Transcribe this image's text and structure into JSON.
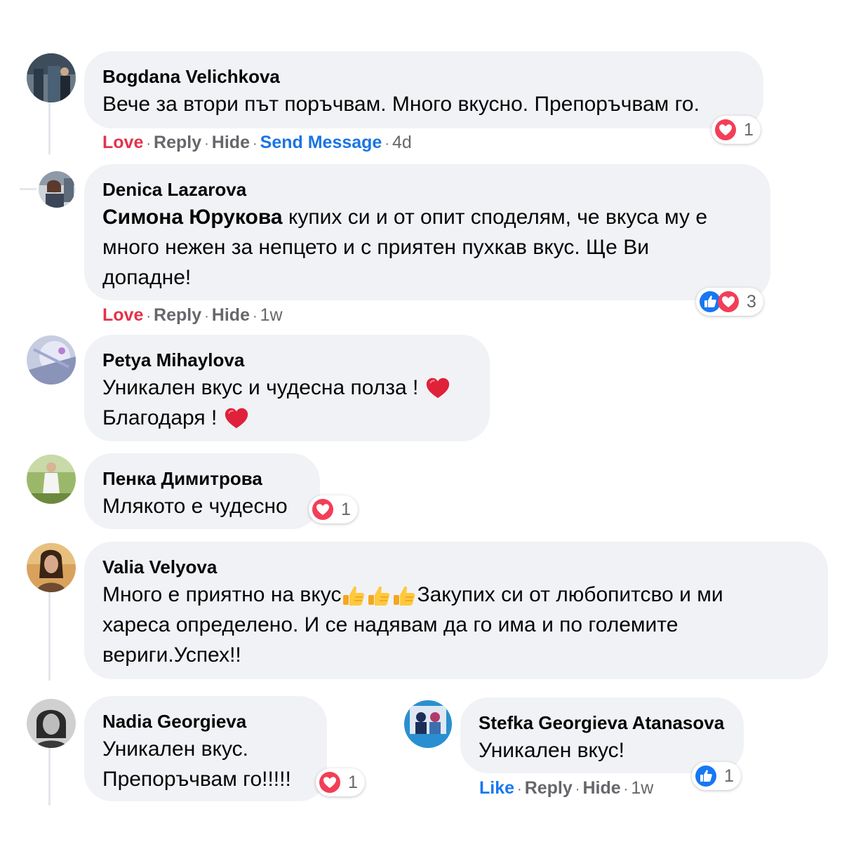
{
  "colors": {
    "bubble": "#f0f2f5",
    "love": "#e4324a",
    "link": "#1877f2",
    "muted": "#65676b",
    "text": "#050505"
  },
  "comments": [
    {
      "author": "Bogdana Velichkova",
      "text": "Вече за втори път поръчвам. Много вкусно. Препоръчвам го.",
      "actions": {
        "love": "Love",
        "reply": "Reply",
        "hide": "Hide",
        "send_message": "Send Message",
        "time": "4d"
      },
      "reactions": {
        "icons": [
          "heart-icon"
        ],
        "count": "1"
      }
    },
    {
      "author": "Denica Lazarova",
      "mention": "Симона Юрукова",
      "text_line1": " купих си и от опит споделям, че вкуса му е",
      "text_line2": "много нежен за непцето и с приятен пухкав вкус. Ще Ви",
      "text_line3": "допадне!",
      "actions": {
        "love": "Love",
        "reply": "Reply",
        "hide": "Hide",
        "time": "1w"
      },
      "reactions": {
        "icons": [
          "like-icon",
          "heart-icon"
        ],
        "count": "3"
      }
    },
    {
      "author": "Petya Mihaylova",
      "text_line1": "Уникален вкус и чудесна полза ! ",
      "text_line2": "Благодаря ! ",
      "emoji": "red-heart-emoji"
    },
    {
      "author": "Пенка Димитрова",
      "text": "Млякото е чудесно",
      "reactions": {
        "icons": [
          "heart-icon"
        ],
        "count": "1"
      }
    },
    {
      "author": "Valia Velyova",
      "text_line1a": "Много е приятно на вкус",
      "text_line1b": "Закупих си от любопитсво и ми",
      "text_line2": "хареса определено. И се надявам да го има и по големите",
      "text_line3": "вериги.Успех!!",
      "emoji": "thumbs-up-emoji"
    },
    {
      "author": "Nadia Georgieva",
      "text_line1": "Уникален вкус.",
      "text_line2": "Препоръчвам го!!!!!",
      "reactions": {
        "icons": [
          "heart-icon"
        ],
        "count": "1"
      }
    },
    {
      "author": "Stefka Georgieva Atanasova",
      "text": "Уникален вкус!",
      "actions": {
        "like": "Like",
        "reply": "Reply",
        "hide": "Hide",
        "time": "1w"
      },
      "reactions": {
        "icons": [
          "like-icon"
        ],
        "count": "1"
      }
    }
  ],
  "separator": "·"
}
